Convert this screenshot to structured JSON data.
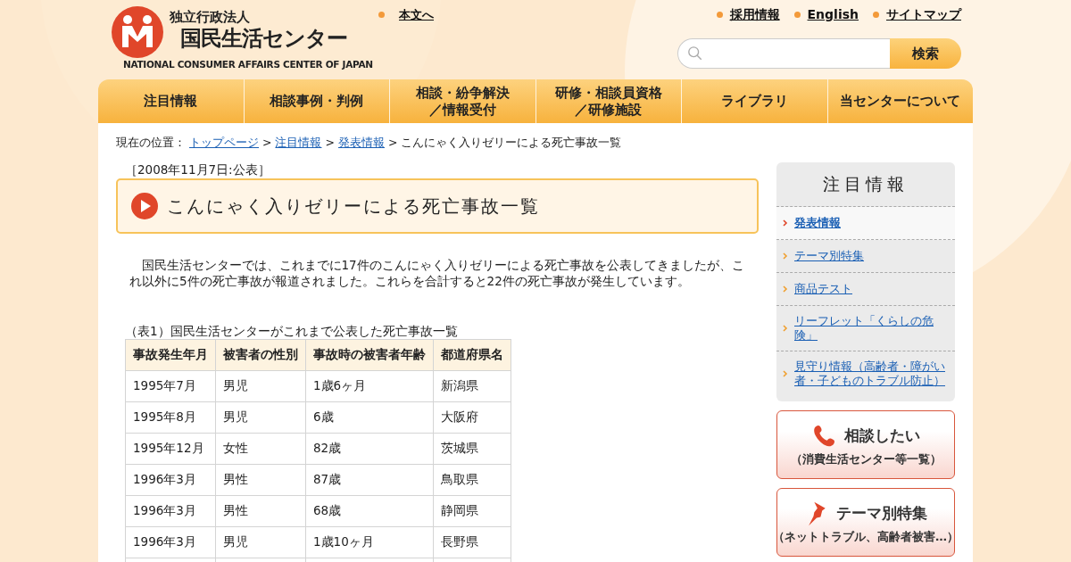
{
  "header": {
    "logo": {
      "line1": "独立行政法人",
      "line2": "国民生活センター",
      "line3": "NATIONAL CONSUMER AFFAIRS CENTER OF JAPAN"
    },
    "skip_link": "本文へ",
    "utility_links": [
      "採用情報",
      "English",
      "サイトマップ"
    ],
    "search": {
      "button": "検索"
    }
  },
  "nav": [
    {
      "lines": [
        "注目情報"
      ]
    },
    {
      "lines": [
        "相談事例・判例"
      ]
    },
    {
      "lines": [
        "相談・紛争解決",
        "／情報受付"
      ]
    },
    {
      "lines": [
        "研修・相談員資格",
        "／研修施設"
      ]
    },
    {
      "lines": [
        "ライブラリ"
      ]
    },
    {
      "lines": [
        "当センターについて"
      ]
    }
  ],
  "breadcrumb": [
    {
      "kind": "text",
      "label": "現在の位置："
    },
    {
      "kind": "link",
      "label": "トップページ"
    },
    {
      "kind": "separator",
      "label": ">"
    },
    {
      "kind": "link",
      "label": "注目情報"
    },
    {
      "kind": "separator",
      "label": ">"
    },
    {
      "kind": "link",
      "label": "発表情報"
    },
    {
      "kind": "separator",
      "label": ">"
    },
    {
      "kind": "text",
      "label": "こんにゃく入りゼリーによる死亡事故一覧"
    }
  ],
  "article": {
    "date": "［2008年11月7日:公表］",
    "title": "こんにゃく入りゼリーによる死亡事故一覧",
    "paragraph": "国民生活センターでは、これまでに17件のこんにゃく入りゼリーによる死亡事故を公表してきましたが、これ以外に5件の死亡事故が報道されました。これらを合計すると22件の死亡事故が発生しています。",
    "table_caption": "（表1）国民生活センターがこれまで公表した死亡事故一覧",
    "table": {
      "columns": [
        "事故発生年月",
        "被害者の性別",
        "事故時の被害者年齢",
        "都道府県名"
      ],
      "rows": [
        [
          "1995年7月",
          "男児",
          "1歳6ヶ月",
          "新潟県"
        ],
        [
          "1995年8月",
          "男児",
          "6歳",
          "大阪府"
        ],
        [
          "1995年12月",
          "女性",
          "82歳",
          "茨城県"
        ],
        [
          "1996年3月",
          "男性",
          "87歳",
          "鳥取県"
        ],
        [
          "1996年3月",
          "男性",
          "68歳",
          "静岡県"
        ],
        [
          "1996年3月",
          "男児",
          "1歳10ヶ月",
          "長野県"
        ]
      ]
    }
  },
  "sidebar": {
    "heading": "注目情報",
    "items": [
      {
        "label": "発表情報",
        "selected": true
      },
      {
        "label": "テーマ別特集",
        "selected": false
      },
      {
        "label": "商品テスト",
        "selected": false
      },
      {
        "label": "リーフレット「くらしの危険」",
        "selected": false
      },
      {
        "label": "見守り情報（高齢者・障がい者・子どものトラブル防止）",
        "selected": false
      }
    ],
    "banners": [
      {
        "kind": "phone",
        "title": "相談したい",
        "subtitle": "（消費生活センター等一覧）"
      },
      {
        "kind": "pin",
        "title": "テーマ別特集",
        "subtitle": "（ネットトラブル、高齢者被害…）"
      }
    ]
  }
}
